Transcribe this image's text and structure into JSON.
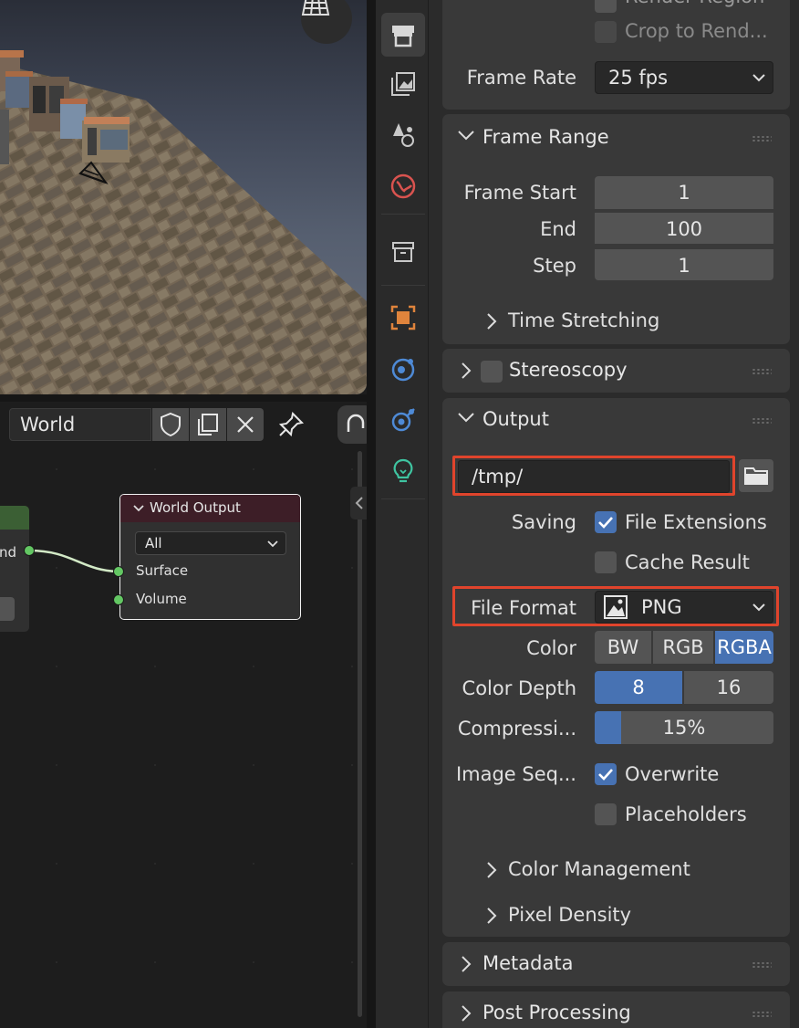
{
  "node_editor": {
    "header": {
      "world_name": "World"
    },
    "left_node": {
      "socket_label": "nd"
    },
    "world_output": {
      "title": "World Output",
      "target": "All",
      "sockets": [
        "Surface",
        "Volume"
      ]
    }
  },
  "tabs": [
    {
      "name": "render-tab",
      "icon": "printer-icon"
    },
    {
      "name": "output-tab",
      "icon": "image-icon"
    },
    {
      "name": "view-layer-tab",
      "icon": "view-layer-icon"
    },
    {
      "name": "scene-tab",
      "icon": "scene-icon"
    },
    {
      "name": "collection-tab",
      "icon": "box-icon"
    },
    {
      "name": "object-tab",
      "icon": "object-square-icon"
    },
    {
      "name": "physics-tab",
      "icon": "physics-icon"
    },
    {
      "name": "constraints-tab",
      "icon": "constraint-icon"
    },
    {
      "name": "data-tab",
      "icon": "light-bulb-icon"
    }
  ],
  "format_panel": {
    "render_region_label": "Render Region",
    "crop_label": "Crop to Rend...",
    "frame_rate_label": "Frame Rate",
    "frame_rate_value": "25 fps"
  },
  "frame_range": {
    "title": "Frame Range",
    "start_label": "Frame Start",
    "start_value": "1",
    "end_label": "End",
    "end_value": "100",
    "step_label": "Step",
    "step_value": "1",
    "time_stretching": "Time Stretching"
  },
  "stereoscopy": {
    "title": "Stereoscopy"
  },
  "output": {
    "title": "Output",
    "path": "/tmp/",
    "saving_label": "Saving",
    "file_extensions": "File Extensions",
    "cache_result": "Cache Result",
    "file_format_label": "File Format",
    "file_format_value": "PNG",
    "color_label": "Color",
    "color_options": [
      "BW",
      "RGB",
      "RGBA"
    ],
    "color_selected": "RGBA",
    "color_depth_label": "Color Depth",
    "depth_options": [
      "8",
      "16"
    ],
    "depth_selected": "8",
    "compression_label": "Compressi...",
    "compression_value": "15%",
    "compression_fraction": 0.15,
    "image_seq_label": "Image Seq...",
    "overwrite": "Overwrite",
    "placeholders": "Placeholders",
    "color_management": "Color Management",
    "pixel_density": "Pixel Density"
  },
  "metadata": {
    "title": "Metadata"
  },
  "post_processing": {
    "title": "Post Processing"
  },
  "colors": {
    "accent": "#4772b3",
    "highlight": "#e0442c"
  }
}
